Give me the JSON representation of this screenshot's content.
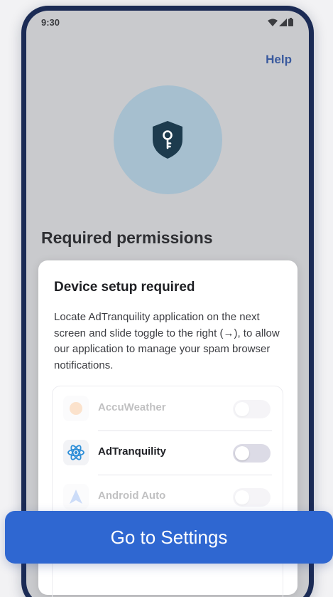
{
  "status_bar": {
    "time": "9:30",
    "icons": [
      "wifi-icon",
      "cell-signal-icon",
      "battery-icon"
    ]
  },
  "header": {
    "help_label": "Help"
  },
  "hero": {
    "icon": "shield-key-icon"
  },
  "page": {
    "title": "Required permissions"
  },
  "dialog": {
    "title": "Device setup required",
    "body": "Locate AdTranquility application on the next screen and slide toggle to the right (→), to allow our application to manage your spam browser notifications.",
    "apps": [
      {
        "name": "AccuWeather",
        "icon": "accuweather-icon",
        "enabled": false,
        "highlighted": false
      },
      {
        "name": "AdTranquility",
        "icon": "react-atom-icon",
        "enabled": false,
        "highlighted": true
      },
      {
        "name": "Android Auto",
        "icon": "android-auto-icon",
        "enabled": false,
        "highlighted": false
      }
    ]
  },
  "cta": {
    "label": "Go to Settings"
  },
  "colors": {
    "accent": "#2f67d1",
    "help_link": "#3a5a9e",
    "shield": "#1d3b4e",
    "frame": "#1b2b55"
  }
}
